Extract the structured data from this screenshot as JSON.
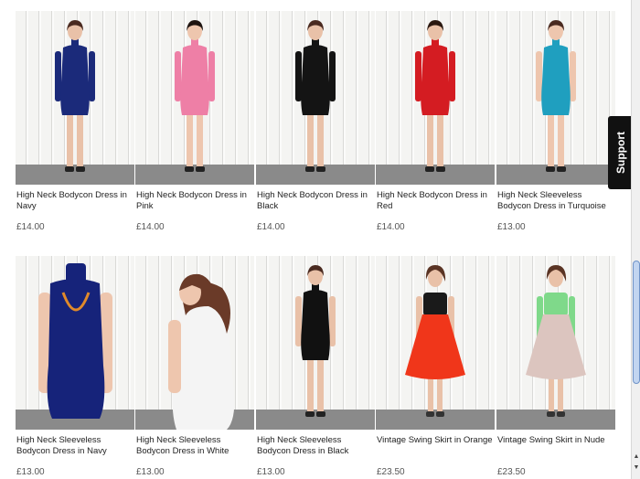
{
  "support": {
    "label": "Support"
  },
  "products": [
    {
      "name": "High Neck Bodycon Dress in Navy",
      "price": "£14.00",
      "color": "#1b2a7a",
      "style": "long-sleeve-dress",
      "skin": "#e9c1a8",
      "hair": "#4a2a20"
    },
    {
      "name": "High Neck Bodycon Dress in Pink",
      "price": "£14.00",
      "color": "#ee7fa6",
      "style": "long-sleeve-dress",
      "skin": "#eec6ae",
      "hair": "#1e1410"
    },
    {
      "name": "High Neck Bodycon Dress in Black",
      "price": "£14.00",
      "color": "#141414",
      "style": "long-sleeve-dress",
      "skin": "#e9c1a8",
      "hair": "#4a2a20"
    },
    {
      "name": "High Neck Bodycon Dress in Red",
      "price": "£14.00",
      "color": "#d41c22",
      "style": "long-sleeve-dress",
      "skin": "#e9c1a8",
      "hair": "#2a1810"
    },
    {
      "name": "High Neck Sleeveless Bodycon Dress in Turquoise",
      "price": "£13.00",
      "color": "#1f9fbf",
      "style": "sleeveless-dress",
      "skin": "#eec6ae",
      "hair": "#4a2a20"
    },
    {
      "name": "High Neck Sleeveless Bodycon Dress in Navy",
      "price": "£13.00",
      "color": "#16237a",
      "style": "sleeveless-close",
      "skin": "#eec6ae",
      "hair": "#4a2a20"
    },
    {
      "name": "High Neck Sleeveless Bodycon Dress in White",
      "price": "£13.00",
      "color": "#f4f4f4",
      "style": "sleeveless-back",
      "skin": "#eec6ae",
      "hair": "#6a3a28"
    },
    {
      "name": "High Neck Sleeveless Bodycon Dress in Black",
      "price": "£13.00",
      "color": "#111111",
      "style": "sleeveless-dress",
      "skin": "#e9c1a8",
      "hair": "#4a2a20"
    },
    {
      "name": "Vintage Swing Skirt in Orange",
      "price": "£23.50",
      "color": "#f0361a",
      "style": "swing-skirt",
      "top": "#1a1a1a",
      "skin": "#e9c1a8",
      "hair": "#5a3424"
    },
    {
      "name": "Vintage Swing Skirt in Nude",
      "price": "£23.50",
      "color": "#dcc5bf",
      "style": "swing-skirt",
      "top": "#7fd98a",
      "skin": "#e9c1a8",
      "hair": "#5a3424"
    }
  ]
}
